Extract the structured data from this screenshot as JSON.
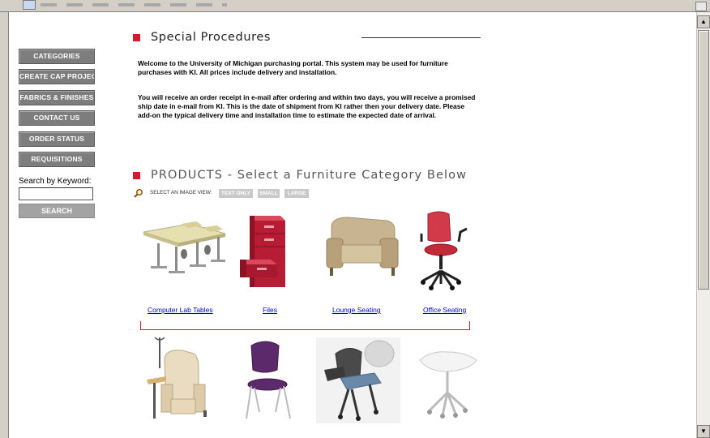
{
  "sidebar": {
    "items": [
      {
        "label": "CATEGORIES"
      },
      {
        "label": "CREATE CAP PROJECT"
      },
      {
        "label": "FABRICS & FINISHES"
      },
      {
        "label": "CONTACT US"
      },
      {
        "label": "ORDER STATUS"
      },
      {
        "label": "REQUISITIONS"
      }
    ],
    "search_label": "Search by Keyword:",
    "search_value": "",
    "search_button": "SEARCH"
  },
  "main": {
    "special_title": "Special Procedures",
    "para1": "Welcome to the University of Michigan purchasing portal. This system may be used for furniture purchases with KI. All prices include delivery and installation.",
    "para2": "You will receive an order receipt in e-mail after ordering and within two days, you will receive a promised ship date in e-mail from KI. This is the date of shipment from KI rather then your delivery date. Please add-on the typical delivery time and installation time to estimate the expected date of arrival.",
    "products_title": "PRODUCTS - Select a Furniture Category Below",
    "view_label": "SELECT AN IMAGE VIEW:",
    "view_options": [
      "TEXT ONLY",
      "SMALL",
      "LARGE"
    ],
    "products": [
      {
        "label": "Computer Lab Tables"
      },
      {
        "label": "Files"
      },
      {
        "label": "Lounge Seating"
      },
      {
        "label": "Office Seating"
      }
    ]
  },
  "colors": {
    "accent": "#d6192d",
    "nav_button": "#7d7d7d",
    "link": "#0000cc"
  }
}
